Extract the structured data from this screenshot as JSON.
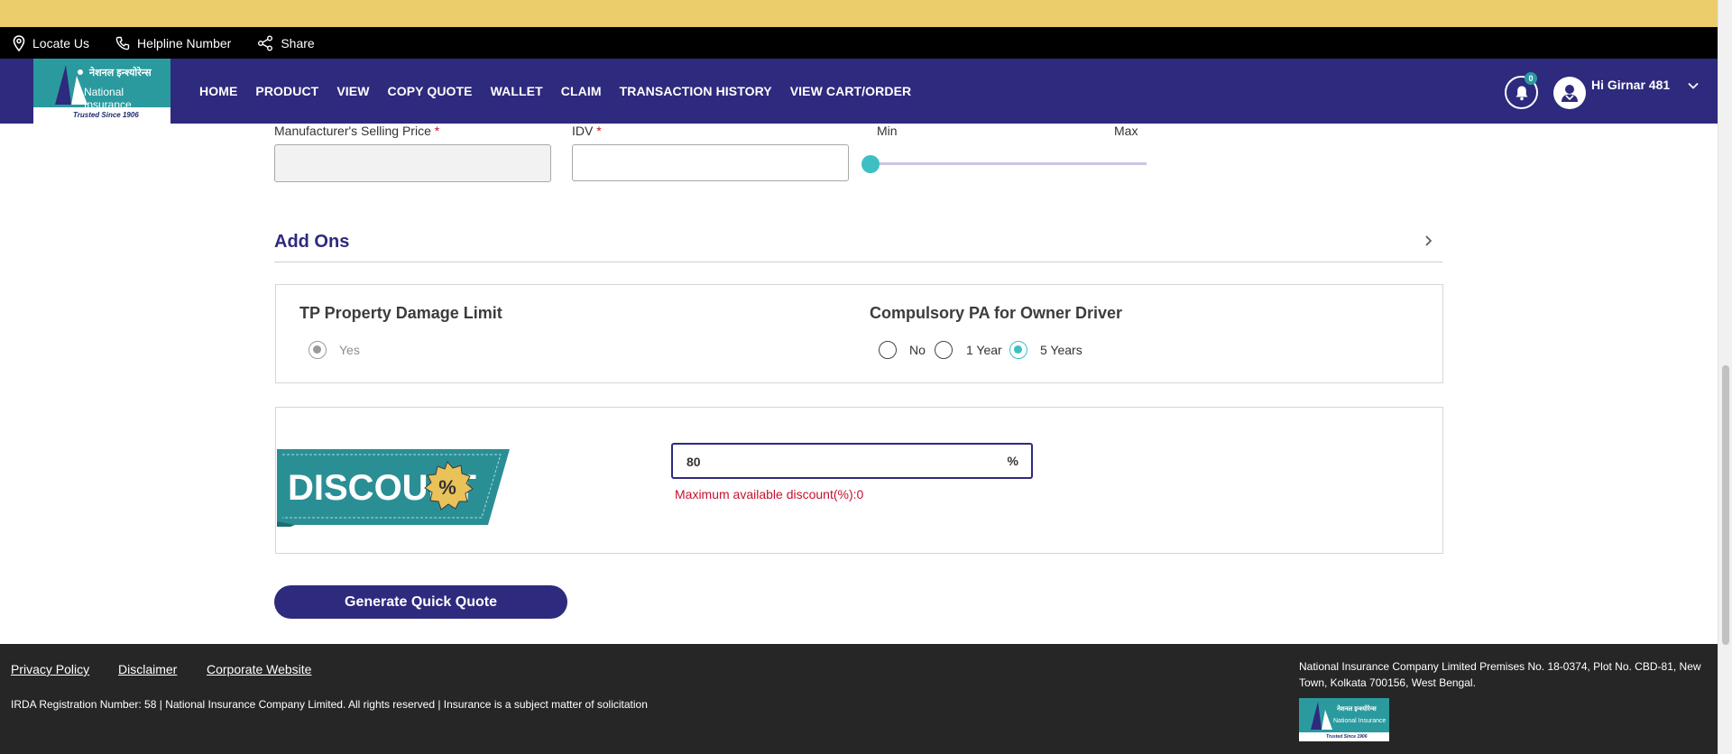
{
  "utility_bar": {
    "locate_us": "Locate Us",
    "helpline": "Helpline Number",
    "share": "Share"
  },
  "brand": {
    "hindi_name": "नेशनल इन्श्योरेन्स",
    "english_name": "National Insurance",
    "tagline": "Trusted Since 1906",
    "primary_color": "#2e2a7d",
    "teal_color": "#2a9a9f"
  },
  "nav": {
    "items": [
      "HOME",
      "PRODUCT",
      "VIEW",
      "COPY QUOTE",
      "WALLET",
      "CLAIM",
      "TRANSACTION HISTORY",
      "VIEW CART/ORDER"
    ],
    "notification_count": "0",
    "user_greeting": "Hi Girnar 481"
  },
  "pricing": {
    "msp_label": "Manufacturer's Selling Price",
    "msp_value": "",
    "idv_label": "IDV",
    "idv_value": "",
    "required_marker": "*",
    "slider_min_label": "Min",
    "slider_max_label": "Max",
    "slider_level": 0
  },
  "addons": {
    "title": "Add Ons",
    "tp_property": {
      "heading": "TP Property Damage Limit",
      "options": [
        {
          "label": "Yes",
          "selected": true,
          "disabled": true
        }
      ]
    },
    "pa_owner": {
      "heading": "Compulsory PA for Owner Driver",
      "options": [
        {
          "label": "No",
          "selected": false
        },
        {
          "label": "1 Year",
          "selected": false
        },
        {
          "label": "5 Years",
          "selected": true
        }
      ]
    }
  },
  "discount": {
    "banner_text": "DISCOUNT",
    "badge_symbol": "%",
    "value": "80",
    "suffix": "%",
    "error": "Maximum available discount(%):0"
  },
  "actions": {
    "generate_quote": "Generate Quick Quote"
  },
  "footer": {
    "links": [
      "Privacy Policy",
      "Disclaimer",
      "Corporate Website"
    ],
    "copyright": "IRDA Registration Number: 58 | National Insurance Company Limited. All rights reserved | Insurance is a subject matter of solicitation",
    "address": "National Insurance Company Limited Premises No. 18-0374, Plot No. CBD-81, New Town, Kolkata 700156, West Bengal."
  }
}
